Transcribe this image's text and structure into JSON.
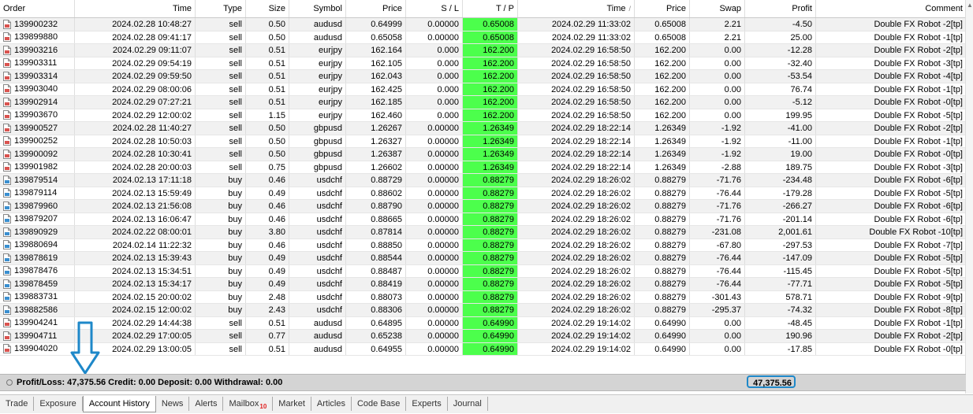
{
  "headers": {
    "order": "Order",
    "time": "Time",
    "type": "Type",
    "size": "Size",
    "symbol": "Symbol",
    "price": "Price",
    "sl": "S / L",
    "tp": "T / P",
    "close_time": "Time",
    "close_price": "Price",
    "swap": "Swap",
    "profit": "Profit",
    "comment": "Comment"
  },
  "rows": [
    {
      "order": "139900232",
      "time": "2024.02.28 10:48:27",
      "type": "sell",
      "size": "0.50",
      "symbol": "audusd",
      "price": "0.64999",
      "sl": "0.00000",
      "tp": "0.65008",
      "close_time": "2024.02.29 11:33:02",
      "close_price": "0.65008",
      "swap": "2.21",
      "profit": "-4.50",
      "comment": "Double FX Robot -2[tp]"
    },
    {
      "order": "139899880",
      "time": "2024.02.28 09:41:17",
      "type": "sell",
      "size": "0.50",
      "symbol": "audusd",
      "price": "0.65058",
      "sl": "0.00000",
      "tp": "0.65008",
      "close_time": "2024.02.29 11:33:02",
      "close_price": "0.65008",
      "swap": "2.21",
      "profit": "25.00",
      "comment": "Double FX Robot -1[tp]"
    },
    {
      "order": "139903216",
      "time": "2024.02.29 09:11:07",
      "type": "sell",
      "size": "0.51",
      "symbol": "eurjpy",
      "price": "162.164",
      "sl": "0.000",
      "tp": "162.200",
      "close_time": "2024.02.29 16:58:50",
      "close_price": "162.200",
      "swap": "0.00",
      "profit": "-12.28",
      "comment": "Double FX Robot -2[tp]"
    },
    {
      "order": "139903311",
      "time": "2024.02.29 09:54:19",
      "type": "sell",
      "size": "0.51",
      "symbol": "eurjpy",
      "price": "162.105",
      "sl": "0.000",
      "tp": "162.200",
      "close_time": "2024.02.29 16:58:50",
      "close_price": "162.200",
      "swap": "0.00",
      "profit": "-32.40",
      "comment": "Double FX Robot -3[tp]"
    },
    {
      "order": "139903314",
      "time": "2024.02.29 09:59:50",
      "type": "sell",
      "size": "0.51",
      "symbol": "eurjpy",
      "price": "162.043",
      "sl": "0.000",
      "tp": "162.200",
      "close_time": "2024.02.29 16:58:50",
      "close_price": "162.200",
      "swap": "0.00",
      "profit": "-53.54",
      "comment": "Double FX Robot -4[tp]"
    },
    {
      "order": "139903040",
      "time": "2024.02.29 08:00:06",
      "type": "sell",
      "size": "0.51",
      "symbol": "eurjpy",
      "price": "162.425",
      "sl": "0.000",
      "tp": "162.200",
      "close_time": "2024.02.29 16:58:50",
      "close_price": "162.200",
      "swap": "0.00",
      "profit": "76.74",
      "comment": "Double FX Robot -1[tp]"
    },
    {
      "order": "139902914",
      "time": "2024.02.29 07:27:21",
      "type": "sell",
      "size": "0.51",
      "symbol": "eurjpy",
      "price": "162.185",
      "sl": "0.000",
      "tp": "162.200",
      "close_time": "2024.02.29 16:58:50",
      "close_price": "162.200",
      "swap": "0.00",
      "profit": "-5.12",
      "comment": "Double FX Robot -0[tp]"
    },
    {
      "order": "139903670",
      "time": "2024.02.29 12:00:02",
      "type": "sell",
      "size": "1.15",
      "symbol": "eurjpy",
      "price": "162.460",
      "sl": "0.000",
      "tp": "162.200",
      "close_time": "2024.02.29 16:58:50",
      "close_price": "162.200",
      "swap": "0.00",
      "profit": "199.95",
      "comment": "Double FX Robot -5[tp]"
    },
    {
      "order": "139900527",
      "time": "2024.02.28 11:40:27",
      "type": "sell",
      "size": "0.50",
      "symbol": "gbpusd",
      "price": "1.26267",
      "sl": "0.00000",
      "tp": "1.26349",
      "close_time": "2024.02.29 18:22:14",
      "close_price": "1.26349",
      "swap": "-1.92",
      "profit": "-41.00",
      "comment": "Double FX Robot -2[tp]"
    },
    {
      "order": "139900252",
      "time": "2024.02.28 10:50:03",
      "type": "sell",
      "size": "0.50",
      "symbol": "gbpusd",
      "price": "1.26327",
      "sl": "0.00000",
      "tp": "1.26349",
      "close_time": "2024.02.29 18:22:14",
      "close_price": "1.26349",
      "swap": "-1.92",
      "profit": "-11.00",
      "comment": "Double FX Robot -1[tp]"
    },
    {
      "order": "139900092",
      "time": "2024.02.28 10:30:41",
      "type": "sell",
      "size": "0.50",
      "symbol": "gbpusd",
      "price": "1.26387",
      "sl": "0.00000",
      "tp": "1.26349",
      "close_time": "2024.02.29 18:22:14",
      "close_price": "1.26349",
      "swap": "-1.92",
      "profit": "19.00",
      "comment": "Double FX Robot -0[tp]"
    },
    {
      "order": "139901982",
      "time": "2024.02.28 20:00:03",
      "type": "sell",
      "size": "0.75",
      "symbol": "gbpusd",
      "price": "1.26602",
      "sl": "0.00000",
      "tp": "1.26349",
      "close_time": "2024.02.29 18:22:14",
      "close_price": "1.26349",
      "swap": "-2.88",
      "profit": "189.75",
      "comment": "Double FX Robot -3[tp]"
    },
    {
      "order": "139879514",
      "time": "2024.02.13 17:11:18",
      "type": "buy",
      "size": "0.46",
      "symbol": "usdchf",
      "price": "0.88729",
      "sl": "0.00000",
      "tp": "0.88279",
      "close_time": "2024.02.29 18:26:02",
      "close_price": "0.88279",
      "swap": "-71.76",
      "profit": "-234.48",
      "comment": "Double FX Robot -6[tp]"
    },
    {
      "order": "139879114",
      "time": "2024.02.13 15:59:49",
      "type": "buy",
      "size": "0.49",
      "symbol": "usdchf",
      "price": "0.88602",
      "sl": "0.00000",
      "tp": "0.88279",
      "close_time": "2024.02.29 18:26:02",
      "close_price": "0.88279",
      "swap": "-76.44",
      "profit": "-179.28",
      "comment": "Double FX Robot -5[tp]"
    },
    {
      "order": "139879960",
      "time": "2024.02.13 21:56:08",
      "type": "buy",
      "size": "0.46",
      "symbol": "usdchf",
      "price": "0.88790",
      "sl": "0.00000",
      "tp": "0.88279",
      "close_time": "2024.02.29 18:26:02",
      "close_price": "0.88279",
      "swap": "-71.76",
      "profit": "-266.27",
      "comment": "Double FX Robot -6[tp]"
    },
    {
      "order": "139879207",
      "time": "2024.02.13 16:06:47",
      "type": "buy",
      "size": "0.46",
      "symbol": "usdchf",
      "price": "0.88665",
      "sl": "0.00000",
      "tp": "0.88279",
      "close_time": "2024.02.29 18:26:02",
      "close_price": "0.88279",
      "swap": "-71.76",
      "profit": "-201.14",
      "comment": "Double FX Robot -6[tp]"
    },
    {
      "order": "139890929",
      "time": "2024.02.22 08:00:01",
      "type": "buy",
      "size": "3.80",
      "symbol": "usdchf",
      "price": "0.87814",
      "sl": "0.00000",
      "tp": "0.88279",
      "close_time": "2024.02.29 18:26:02",
      "close_price": "0.88279",
      "swap": "-231.08",
      "profit": "2,001.61",
      "comment": "Double FX Robot -10[tp]"
    },
    {
      "order": "139880694",
      "time": "2024.02.14 11:22:32",
      "type": "buy",
      "size": "0.46",
      "symbol": "usdchf",
      "price": "0.88850",
      "sl": "0.00000",
      "tp": "0.88279",
      "close_time": "2024.02.29 18:26:02",
      "close_price": "0.88279",
      "swap": "-67.80",
      "profit": "-297.53",
      "comment": "Double FX Robot -7[tp]"
    },
    {
      "order": "139878619",
      "time": "2024.02.13 15:39:43",
      "type": "buy",
      "size": "0.49",
      "symbol": "usdchf",
      "price": "0.88544",
      "sl": "0.00000",
      "tp": "0.88279",
      "close_time": "2024.02.29 18:26:02",
      "close_price": "0.88279",
      "swap": "-76.44",
      "profit": "-147.09",
      "comment": "Double FX Robot -5[tp]"
    },
    {
      "order": "139878476",
      "time": "2024.02.13 15:34:51",
      "type": "buy",
      "size": "0.49",
      "symbol": "usdchf",
      "price": "0.88487",
      "sl": "0.00000",
      "tp": "0.88279",
      "close_time": "2024.02.29 18:26:02",
      "close_price": "0.88279",
      "swap": "-76.44",
      "profit": "-115.45",
      "comment": "Double FX Robot -5[tp]"
    },
    {
      "order": "139878459",
      "time": "2024.02.13 15:34:17",
      "type": "buy",
      "size": "0.49",
      "symbol": "usdchf",
      "price": "0.88419",
      "sl": "0.00000",
      "tp": "0.88279",
      "close_time": "2024.02.29 18:26:02",
      "close_price": "0.88279",
      "swap": "-76.44",
      "profit": "-77.71",
      "comment": "Double FX Robot -5[tp]"
    },
    {
      "order": "139883731",
      "time": "2024.02.15 20:00:02",
      "type": "buy",
      "size": "2.48",
      "symbol": "usdchf",
      "price": "0.88073",
      "sl": "0.00000",
      "tp": "0.88279",
      "close_time": "2024.02.29 18:26:02",
      "close_price": "0.88279",
      "swap": "-301.43",
      "profit": "578.71",
      "comment": "Double FX Robot -9[tp]"
    },
    {
      "order": "139882586",
      "time": "2024.02.15 12:00:02",
      "type": "buy",
      "size": "2.43",
      "symbol": "usdchf",
      "price": "0.88306",
      "sl": "0.00000",
      "tp": "0.88279",
      "close_time": "2024.02.29 18:26:02",
      "close_price": "0.88279",
      "swap": "-295.37",
      "profit": "-74.32",
      "comment": "Double FX Robot -8[tp]"
    },
    {
      "order": "139904241",
      "time": "2024.02.29 14:44:38",
      "type": "sell",
      "size": "0.51",
      "symbol": "audusd",
      "price": "0.64895",
      "sl": "0.00000",
      "tp": "0.64990",
      "close_time": "2024.02.29 19:14:02",
      "close_price": "0.64990",
      "swap": "0.00",
      "profit": "-48.45",
      "comment": "Double FX Robot -1[tp]"
    },
    {
      "order": "139904711",
      "time": "2024.02.29 17:00:05",
      "type": "sell",
      "size": "0.77",
      "symbol": "audusd",
      "price": "0.65238",
      "sl": "0.00000",
      "tp": "0.64990",
      "close_time": "2024.02.29 19:14:02",
      "close_price": "0.64990",
      "swap": "0.00",
      "profit": "190.96",
      "comment": "Double FX Robot -2[tp]"
    },
    {
      "order": "139904020",
      "time": "2024.02.29 13:00:05",
      "type": "sell",
      "size": "0.51",
      "symbol": "audusd",
      "price": "0.64955",
      "sl": "0.00000",
      "tp": "0.64990",
      "close_time": "2024.02.29 19:14:02",
      "close_price": "0.64990",
      "swap": "0.00",
      "profit": "-17.85",
      "comment": "Double FX Robot -0[tp]"
    }
  ],
  "summary": {
    "text": "Profit/Loss: 47,375.56  Credit: 0.00  Deposit: 0.00  Withdrawal: 0.00",
    "total": "47,375.56"
  },
  "tabs": [
    {
      "label": "Trade",
      "active": false
    },
    {
      "label": "Exposure",
      "active": false
    },
    {
      "label": "Account History",
      "active": true
    },
    {
      "label": "News",
      "active": false
    },
    {
      "label": "Alerts",
      "active": false
    },
    {
      "label": "Mailbox",
      "active": false,
      "badge": "10"
    },
    {
      "label": "Market",
      "active": false
    },
    {
      "label": "Articles",
      "active": false
    },
    {
      "label": "Code Base",
      "active": false
    },
    {
      "label": "Experts",
      "active": false
    },
    {
      "label": "Journal",
      "active": false
    }
  ],
  "colors": {
    "tp_highlight": "#4cff4c",
    "total_border": "#1e88c9",
    "arrow": "#1e88c9",
    "sell_icon": "#d9534f",
    "buy_icon": "#3a8fd0"
  },
  "icons": {
    "sell": "sell-order-doc-icon",
    "buy": "buy-order-doc-icon",
    "arrow": "down-arrow-annotation"
  }
}
